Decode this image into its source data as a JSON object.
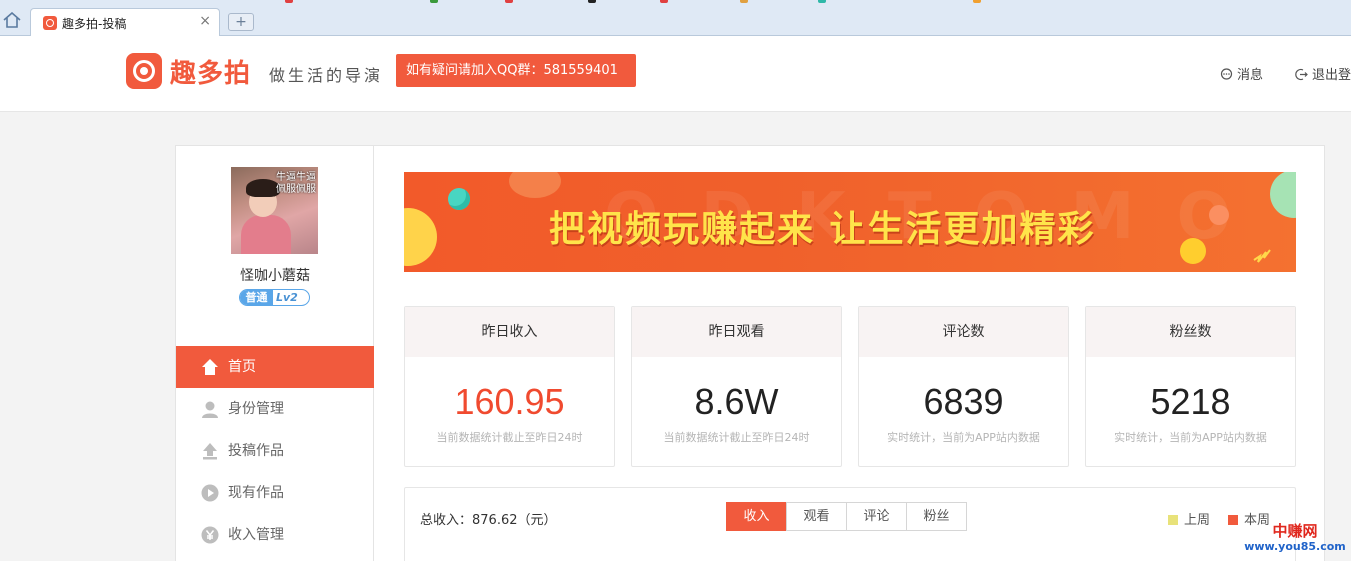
{
  "browser": {
    "tab_title": "趣多拍-投稿",
    "close_glyph": "×",
    "new_tab_glyph": "+"
  },
  "header": {
    "logo_text": "趣多拍",
    "slogan": "做生活的导演",
    "qq_notice": "如有疑问请加入QQ群：581559401",
    "messages_label": "消息",
    "logout_label": "退出登"
  },
  "profile": {
    "avatar_overlay": "牛逼牛逼 佩服佩服",
    "username": "怪咖小蘑菇",
    "level_tag": "普通",
    "level": "Lv2"
  },
  "sidebar": {
    "items": [
      {
        "label": "首页",
        "icon": "home-icon",
        "active": true
      },
      {
        "label": "身份管理",
        "icon": "user-icon",
        "active": false
      },
      {
        "label": "投稿作品",
        "icon": "upload-icon",
        "active": false
      },
      {
        "label": "现有作品",
        "icon": "play-icon",
        "active": false
      },
      {
        "label": "收入管理",
        "icon": "yen-icon",
        "active": false
      }
    ]
  },
  "banner": {
    "text": "把视频玩赚起来  让生活更加精彩",
    "watermark": "Q D K T O M O"
  },
  "stats": [
    {
      "title": "昨日收入",
      "value": "160.95",
      "note": "当前数据统计截止至昨日24时",
      "highlight": true
    },
    {
      "title": "昨日观看",
      "value": "8.6W",
      "note": "当前数据统计截止至昨日24时",
      "highlight": false
    },
    {
      "title": "评论数",
      "value": "6839",
      "note": "实时统计，当前为APP站内数据",
      "highlight": false
    },
    {
      "title": "粉丝数",
      "value": "5218",
      "note": "实时统计，当前为APP站内数据",
      "highlight": false
    }
  ],
  "revenue": {
    "total": "总收入：876.62（元）",
    "tabs": [
      "收入",
      "观看",
      "评论",
      "粉丝"
    ],
    "active_tab": "收入",
    "legend": [
      {
        "label": "上周",
        "color": "#e8e27a"
      },
      {
        "label": "本周",
        "color": "#f15a3d"
      }
    ]
  },
  "watermark": {
    "line1": "中赚网",
    "line2": "www.you85.com"
  },
  "colors": {
    "accent": "#f15a3d",
    "highlight_value": "#f04a2f",
    "level_blue": "#5aa6e8"
  }
}
